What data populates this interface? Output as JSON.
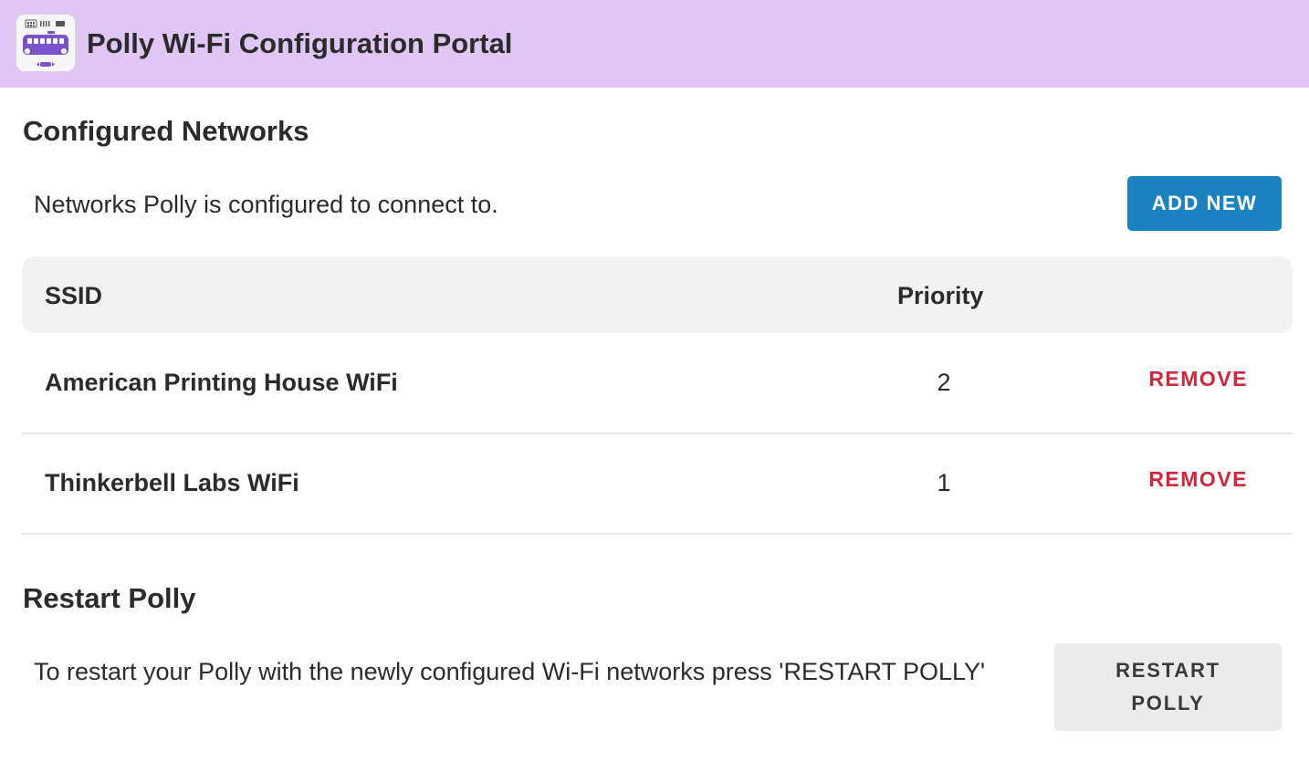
{
  "header": {
    "title": "Polly Wi-Fi Configuration Portal",
    "logo_icon": "polly-device-icon",
    "background": "#dfc6f4"
  },
  "networks_section": {
    "title": "Configured Networks",
    "description": "Networks Polly is configured to connect to.",
    "add_button_label": "ADD NEW",
    "table": {
      "columns": [
        "SSID",
        "Priority"
      ],
      "rows": [
        {
          "ssid": "American Printing House WiFi",
          "priority": "2",
          "action": "REMOVE"
        },
        {
          "ssid": "Thinkerbell Labs WiFi",
          "priority": "1",
          "action": "REMOVE"
        }
      ]
    }
  },
  "restart_section": {
    "title": "Restart Polly",
    "description": "To restart your Polly with the newly configured Wi-Fi networks press 'RESTART POLLY'",
    "button_label": "RESTART POLLY"
  },
  "colors": {
    "accent": "#1b82c0",
    "danger": "#d2263a",
    "header": "#dfc6f4"
  }
}
